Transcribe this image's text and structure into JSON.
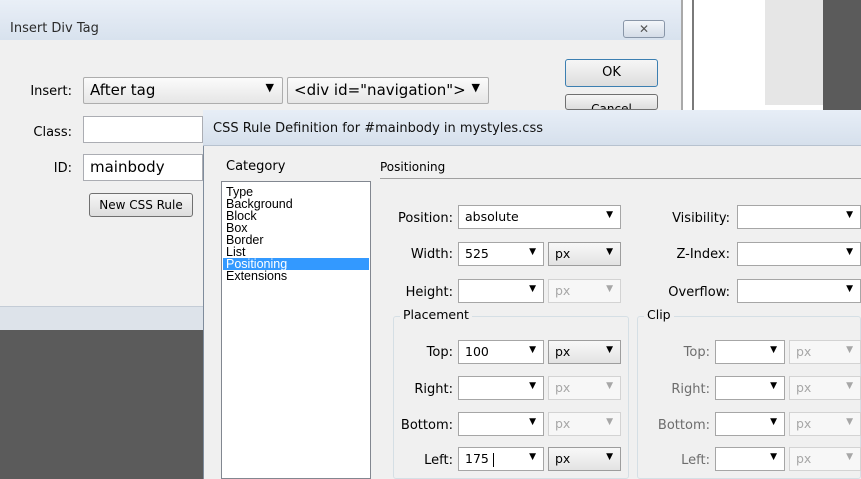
{
  "insert_dialog": {
    "title": "Insert Div Tag",
    "close_glyph": "✕",
    "insert_label": "Insert:",
    "insert_value": "After tag",
    "tag_value": "<div id=\"navigation\">",
    "class_label": "Class:",
    "class_value": "",
    "id_label": "ID:",
    "id_value": "mainbody",
    "new_css_rule_label": "New CSS Rule",
    "ok_label": "OK",
    "cancel_label": "Cancel"
  },
  "css_dialog": {
    "title": "CSS Rule Definition for #mainbody in mystyles.css",
    "category_header": "Category",
    "section_header": "Positioning",
    "categories": [
      "Type",
      "Background",
      "Block",
      "Box",
      "Border",
      "List",
      "Positioning",
      "Extensions"
    ],
    "selected_category": "Positioning",
    "position": {
      "label": "Position:",
      "value": "absolute"
    },
    "width": {
      "label": "Width:",
      "value": "525",
      "unit": "px"
    },
    "height": {
      "label": "Height:",
      "value": "",
      "unit": "px"
    },
    "visibility": {
      "label": "Visibility:",
      "value": ""
    },
    "z_index": {
      "label": "Z-Index:",
      "value": ""
    },
    "overflow": {
      "label": "Overflow:",
      "value": ""
    },
    "placement": {
      "legend": "Placement",
      "top": {
        "label": "Top:",
        "value": "100",
        "unit": "px"
      },
      "right": {
        "label": "Right:",
        "value": "",
        "unit": "px"
      },
      "bottom": {
        "label": "Bottom:",
        "value": "",
        "unit": "px"
      },
      "left": {
        "label": "Left:",
        "value": "175",
        "unit": "px"
      }
    },
    "clip": {
      "legend": "Clip",
      "top": {
        "label": "Top:",
        "value": "",
        "unit": "px"
      },
      "right": {
        "label": "Right:",
        "value": "",
        "unit": "px"
      },
      "bottom": {
        "label": "Bottom:",
        "value": "",
        "unit": "px"
      },
      "left": {
        "label": "Left:",
        "value": "",
        "unit": "px"
      }
    }
  },
  "icons": {
    "dropdown": "dropdown-arrow-icon",
    "close": "close-icon"
  },
  "colors": {
    "selection": "#3399ff",
    "dialog_bg": "#f0f0f0",
    "title_bar": "#dfe7f1",
    "background_dark": "#5b5b5b"
  }
}
